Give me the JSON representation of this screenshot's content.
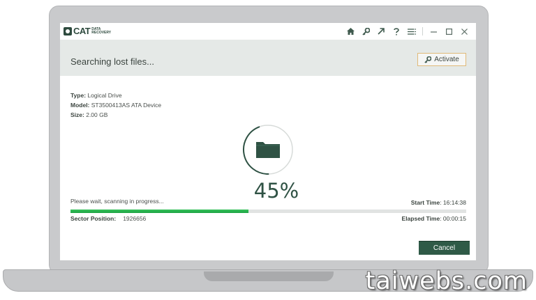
{
  "app": {
    "logo_text": "CAT",
    "logo_subtitle": "DATA RECOVERY"
  },
  "toolbar": {
    "icons": [
      "home-icon",
      "key-icon",
      "share-arrow-icon",
      "help-icon",
      "menu-icon"
    ],
    "window_controls": [
      "minimize-icon",
      "maximize-icon",
      "close-icon"
    ]
  },
  "header": {
    "title": "Searching lost files...",
    "activate_label": "Activate"
  },
  "drive": {
    "type_label": "Type:",
    "type_value": "Logical Drive",
    "model_label": "Model:",
    "model_value": "ST3500413AS ATA Device",
    "size_label": "Size:",
    "size_value": "2.00 GB"
  },
  "scan": {
    "percent_text": "45%",
    "progress": 0.45,
    "status": "Please wait, scanning in progress...",
    "start_time_label": "Start Time",
    "start_time_value": ": 16:14:38",
    "sector_label": "Sector Position:",
    "sector_value": "1926656",
    "elapsed_label": "Elapsed Time",
    "elapsed_value": ": 00:00:15"
  },
  "footer": {
    "cancel_label": "Cancel"
  },
  "colors": {
    "accent": "#2f5a47",
    "progress": "#2bb34f",
    "header_band": "#e5e9e7",
    "activate_border": "#e0b978"
  },
  "watermark": "taiwebs.com"
}
